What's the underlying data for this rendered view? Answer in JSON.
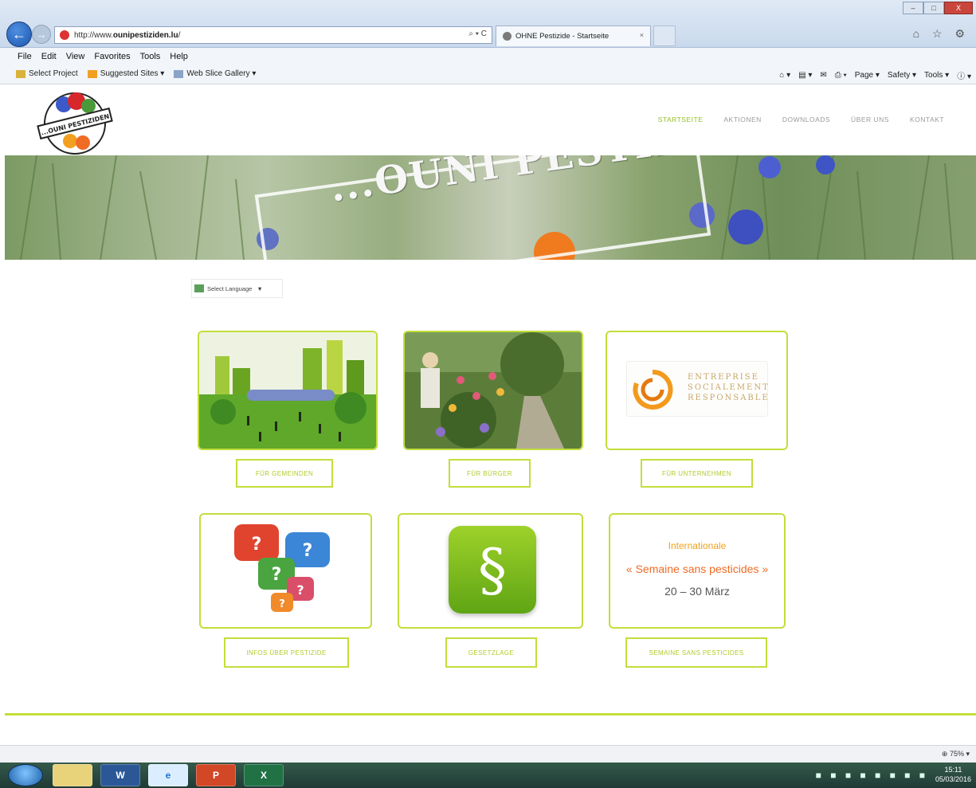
{
  "browser": {
    "url_prefix": "http://www.",
    "url_domain": "ounipestiziden.lu",
    "url_suffix": "/",
    "address_tools": "⌕ ▾ C",
    "tab_title": "OHNE Pestizide - Startseite",
    "tab_close": "×",
    "win_min": "–",
    "win_max": "□",
    "win_close": "X",
    "chrome_icons": "⌂ ☆ ⚙",
    "back_glyph": "←",
    "fwd_glyph": "→"
  },
  "menu": [
    "File",
    "Edit",
    "View",
    "Favorites",
    "Tools",
    "Help"
  ],
  "favorites": {
    "items": [
      "Select Project",
      "Suggested Sites ▾",
      "Web Slice Gallery ▾"
    ],
    "right": [
      "⌂ ▾",
      "▤ ▾",
      "✉",
      "⎙ ▾",
      "Page ▾",
      "Safety ▾",
      "Tools ▾",
      "ⓘ ▾"
    ]
  },
  "site": {
    "logo_text": "...OUNI PESTIZIDEN",
    "nav": [
      {
        "label": "STARTSEITE",
        "active": true
      },
      {
        "label": "AKTIONEN",
        "active": false
      },
      {
        "label": "DOWNLOADS",
        "active": false
      },
      {
        "label": "ÜBER UNS",
        "active": false
      },
      {
        "label": "KONTAKT",
        "active": false
      }
    ],
    "hero_text": "...OUNI PESTIZIDEN",
    "language_select": "Select Language",
    "language_arrow": "▼",
    "cards": [
      {
        "button": "FÜR GEMEINDEN"
      },
      {
        "button": "FÜR BÜRGER"
      },
      {
        "button": "FÜR UNTERNEHMEN",
        "logo_lines": [
          "ENTREPRISE",
          "SOCIALEMENT",
          "RESPONSABLE"
        ]
      },
      {
        "button": "INFOS ÜBER PESTIZIDE"
      },
      {
        "button": "GESETZLAGE",
        "glyph": "§"
      },
      {
        "button": "SEMAINE SANS PESTICIDES",
        "title": "Internationale",
        "subtitle": "« Semaine sans pesticides »",
        "dates": "20 – 30 März"
      }
    ]
  },
  "status": {
    "zoom": "⊕ 75%  ▾"
  },
  "taskbar": {
    "apps": [
      "",
      "W",
      "e",
      "P",
      "X"
    ],
    "tray": "■ ■ ■ ■ ■ ■ ■ ■",
    "time": "15:11",
    "date": "05/03/2016"
  },
  "colors": {
    "accent": "#c3de3b",
    "nav_active": "#93c01f",
    "orange": "#f06b25"
  }
}
